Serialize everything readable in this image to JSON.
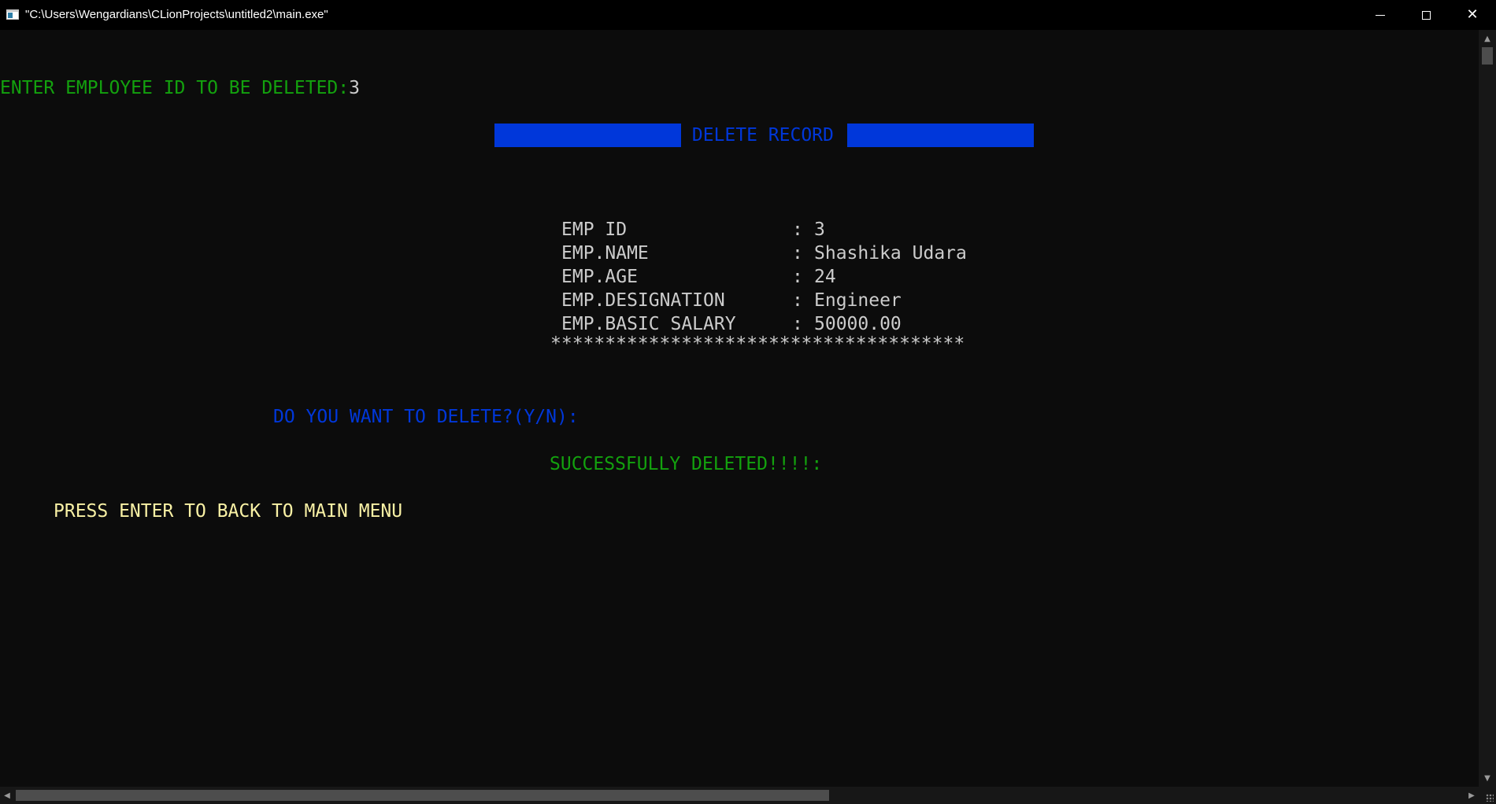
{
  "window": {
    "title": "\"C:\\Users\\Wengardians\\CLionProjects\\untitled2\\main.exe\"",
    "buttons": {
      "minimize": "minimize-icon",
      "maximize": "maximize-icon",
      "close": "close-icon"
    }
  },
  "console": {
    "prompt_id_label": "ENTER EMPLOYEE ID TO BE DELETED:",
    "prompt_id_value": "3",
    "header_title": " DELETE RECORD ",
    "record": [
      {
        "label": "EMP ID",
        "value": "3"
      },
      {
        "label": "EMP.NAME",
        "value": "Shashika Udara"
      },
      {
        "label": "EMP.AGE",
        "value": "24"
      },
      {
        "label": "EMP.DESIGNATION",
        "value": "Engineer"
      },
      {
        "label": "EMP.BASIC SALARY",
        "value": "50000.00"
      }
    ],
    "separator": "**************************************",
    "confirm_prompt": "DO YOU WANT TO DELETE?(Y/N):",
    "success_message": "SUCCESSFULLY DELETED!!!!:",
    "back_prompt": "PRESS ENTER TO BACK TO MAIN MENU"
  },
  "colors": {
    "background": "#0c0c0c",
    "green": "#13a10e",
    "blue": "#0037da",
    "gray": "#cccccc",
    "yellow": "#f9f1a5"
  }
}
